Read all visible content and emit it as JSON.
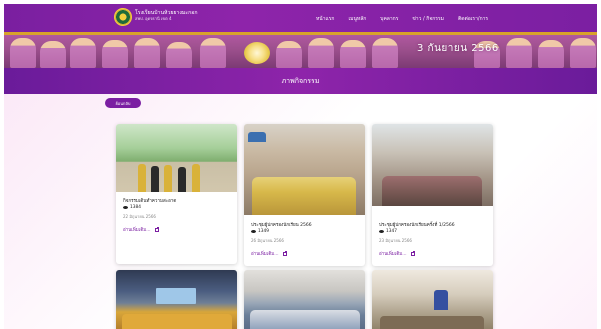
{
  "site": {
    "name": "โรงเรียนบ้านห้วยยางมะกอก",
    "subtitle": "สพป. อุดรธานี เขต 4"
  },
  "menu": [
    "หน้าแรก",
    "เมนูหลัก",
    "บุคลากร",
    "ข่าว / กิจกรรม",
    "ติดต่อเรา/การ"
  ],
  "banner": {
    "date_text": "3 กันยายน 2566"
  },
  "page": {
    "title": "ภาพกิจกรรม",
    "back_label": "ย้อนกลับ"
  },
  "cards": [
    {
      "title": "กิจกรรมเดินทำความสะอาด",
      "views": "1384",
      "date": "22 มิถุนายน 2566",
      "more": "อ่านเพิ่มเติม..."
    },
    {
      "title": "ประชุมผู้ปกครองนักเรียน 2566",
      "views": "1349",
      "date": "26 มิถุนายน 2566",
      "more": "อ่านเพิ่มเติม..."
    },
    {
      "title": "ประชุมผู้ปกครองนักเรียนครั้งที่ 1/2566",
      "views": "1347",
      "date": "23 มิถุนายน 2566",
      "more": "อ่านเพิ่มเติม..."
    }
  ],
  "colors": {
    "brand_purple": "#8e24aa",
    "dark_purple": "#6a1b9a",
    "gold": "#d8a22b"
  },
  "icons": [
    "school-logo-icon",
    "eye-icon",
    "external-link-icon"
  ]
}
